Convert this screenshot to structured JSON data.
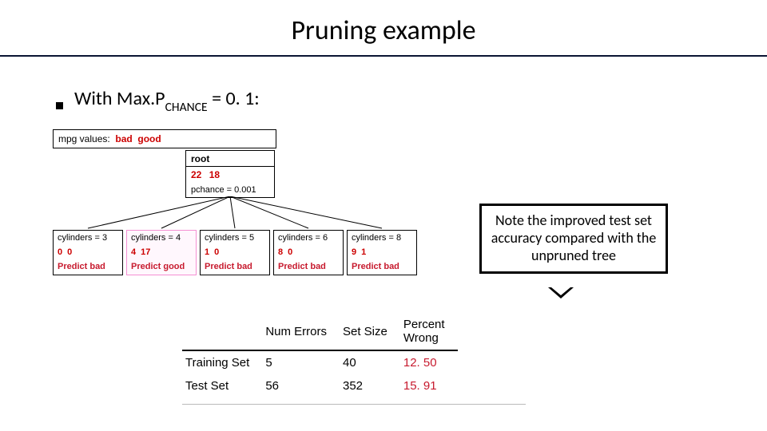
{
  "title": "Pruning example",
  "bullet": {
    "prefix": "With Max.P",
    "sub": "CHANCE",
    "suffix": " = 0. 1:"
  },
  "legend": {
    "label": "mpg values:",
    "bad": "bad",
    "good": "good"
  },
  "root": {
    "label": "root",
    "bad": "22",
    "good": "18",
    "pchance": "pchance = 0.001"
  },
  "leaves": [
    {
      "cond": "cylinders = 3",
      "bad": "0",
      "good": "0",
      "pred": "Predict bad",
      "cls": "bad"
    },
    {
      "cond": "cylinders = 4",
      "bad": "4",
      "good": "17",
      "pred": "Predict good",
      "cls": "good",
      "hl": true
    },
    {
      "cond": "cylinders = 5",
      "bad": "1",
      "good": "0",
      "pred": "Predict bad",
      "cls": "bad"
    },
    {
      "cond": "cylinders = 6",
      "bad": "8",
      "good": "0",
      "pred": "Predict bad",
      "cls": "bad"
    },
    {
      "cond": "cylinders = 8",
      "bad": "9",
      "good": "1",
      "pred": "Predict bad",
      "cls": "bad"
    }
  ],
  "callout": "Note the improved test set accuracy compared with the unpruned tree",
  "table": {
    "headers": [
      "",
      "Num Errors",
      "Set Size",
      "Percent Wrong"
    ],
    "rows": [
      {
        "label": "Training Set",
        "errors": "5",
        "size": "40",
        "pct": "12. 50"
      },
      {
        "label": "Test Set",
        "errors": "56",
        "size": "352",
        "pct": "15. 91"
      }
    ]
  }
}
